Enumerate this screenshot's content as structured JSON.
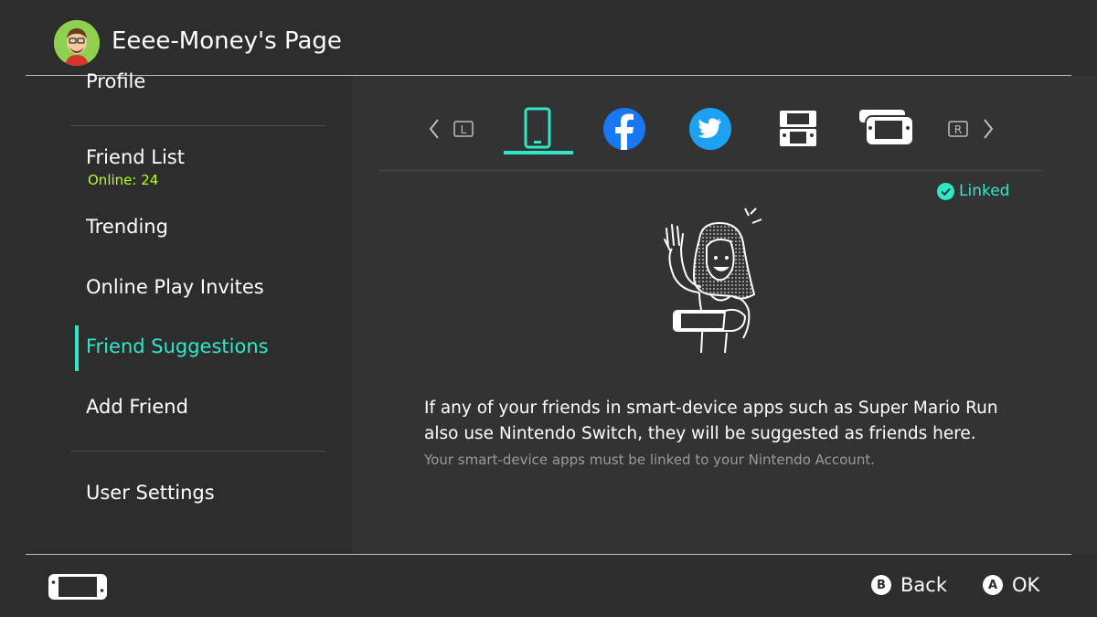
{
  "header": {
    "title": "Eeee-Money's Page"
  },
  "sidebar": {
    "items": [
      {
        "label": "Profile"
      },
      {
        "label": "Friend List",
        "sub": "Online: 24"
      },
      {
        "label": "Trending"
      },
      {
        "label": "Online Play Invites"
      },
      {
        "label": "Friend Suggestions",
        "selected": true
      },
      {
        "label": "Add Friend"
      },
      {
        "label": "User Settings"
      }
    ]
  },
  "tabs": {
    "left_shoulder": "L",
    "right_shoulder": "R",
    "items": [
      {
        "icon": "smart-device-icon",
        "selected": true
      },
      {
        "icon": "facebook-icon"
      },
      {
        "icon": "twitter-icon"
      },
      {
        "icon": "nintendo-3ds-icon"
      },
      {
        "icon": "wii-u-icon"
      }
    ]
  },
  "content": {
    "status": "Linked",
    "message_line1": "If any of your friends in smart-device apps such as Super Mario Run",
    "message_line2": "also use Nintendo Switch, they will be suggested as friends here.",
    "note": "Your smart-device apps must be linked to your Nintendo Account."
  },
  "footer": {
    "back_key": "B",
    "back_label": "Back",
    "ok_key": "A",
    "ok_label": "OK"
  },
  "colors": {
    "accent": "#2ee8c8",
    "online": "#b8ff26",
    "facebook": "#1877f2",
    "twitter": "#1da1f2"
  }
}
